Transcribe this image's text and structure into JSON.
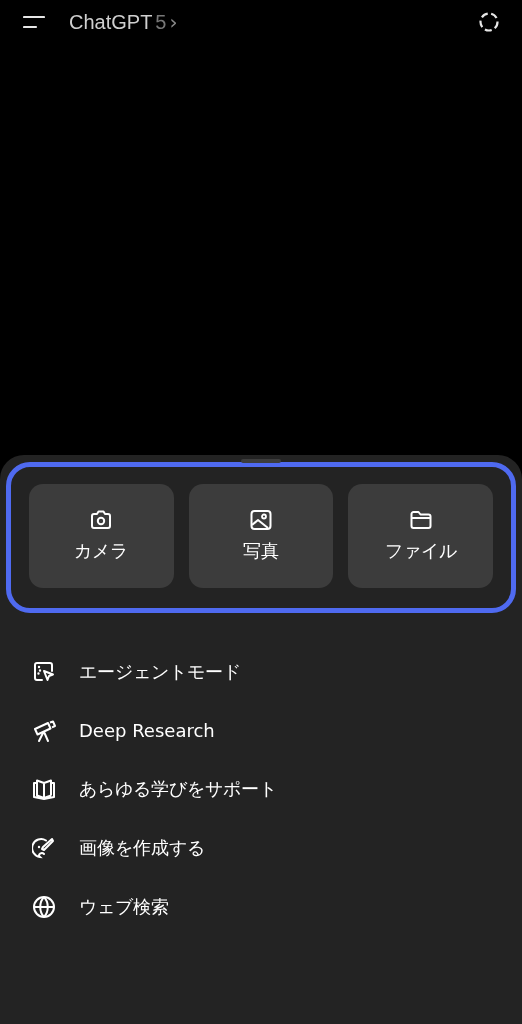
{
  "header": {
    "title": "ChatGPT",
    "version": "5",
    "chevron": "›"
  },
  "attachments": [
    {
      "kind": "camera",
      "label": "カメラ"
    },
    {
      "kind": "photo",
      "label": "写真"
    },
    {
      "kind": "file",
      "label": "ファイル"
    }
  ],
  "menu": [
    {
      "kind": "agent",
      "label": "エージェントモード"
    },
    {
      "kind": "research",
      "label": "Deep Research"
    },
    {
      "kind": "study",
      "label": "あらゆる学びをサポート"
    },
    {
      "kind": "image",
      "label": "画像を作成する"
    },
    {
      "kind": "web",
      "label": "ウェブ検索"
    }
  ]
}
